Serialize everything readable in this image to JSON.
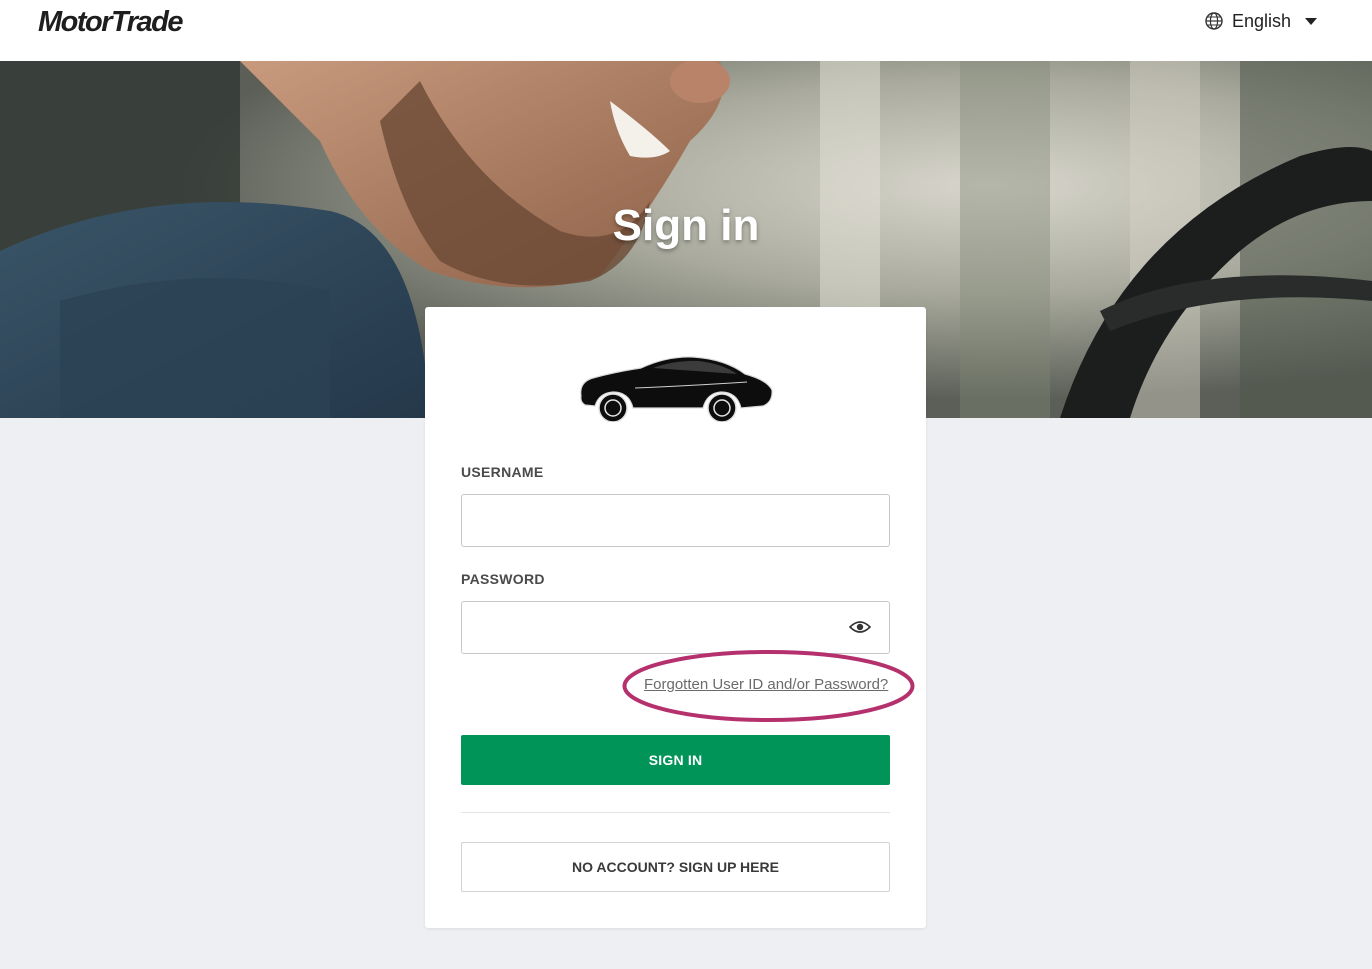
{
  "header": {
    "logo": "MotorTrade",
    "language": "English",
    "language_icon": "globe-icon",
    "language_caret_icon": "caret-down-icon"
  },
  "hero": {
    "title": "Sign in",
    "image": "man-driving-car-photo"
  },
  "login_card": {
    "car_icon": "car-icon",
    "username_label": "USERNAME",
    "username_value": "",
    "password_label": "PASSWORD",
    "password_value": "",
    "password_toggle_icon": "eye-icon",
    "forgot_link": "Forgotten User ID and/or Password?",
    "sign_in_button": "SIGN IN",
    "sign_up_button": "NO ACCOUNT? SIGN UP HERE"
  },
  "colors": {
    "primary_green": "#009459",
    "highlight_ring": "#b5316d",
    "page_background": "#eeeff2"
  }
}
